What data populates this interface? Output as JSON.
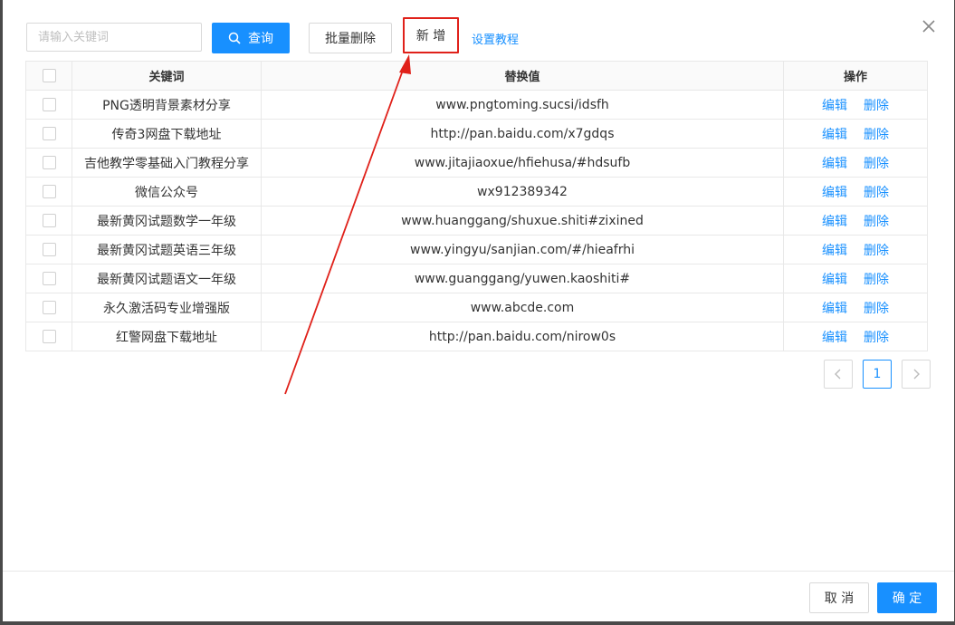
{
  "toolbar": {
    "search_placeholder": "请输入关键词",
    "search_label": "查询",
    "batch_delete_label": "批量删除",
    "add_label": "新 增",
    "tutorial_label": "设置教程"
  },
  "table": {
    "headers": {
      "keyword": "关键词",
      "value": "替换值",
      "actions": "操作"
    },
    "rows": [
      {
        "keyword": "PNG透明背景素材分享",
        "value": "www.pngtoming.sucsi/idsfh",
        "edit": "编辑",
        "delete": "删除"
      },
      {
        "keyword": "传奇3网盘下载地址",
        "value": "http://pan.baidu.com/x7gdqs",
        "edit": "编辑",
        "delete": "删除"
      },
      {
        "keyword": "吉他教学零基础入门教程分享",
        "value": "www.jitajiaoxue/hfiehusa/#hdsufb",
        "edit": "编辑",
        "delete": "删除"
      },
      {
        "keyword": "微信公众号",
        "value": "wx912389342",
        "edit": "编辑",
        "delete": "删除"
      },
      {
        "keyword": "最新黄冈试题数学一年级",
        "value": "www.huanggang/shuxue.shiti#zixined",
        "edit": "编辑",
        "delete": "删除"
      },
      {
        "keyword": "最新黄冈试题英语三年级",
        "value": "www.yingyu/sanjian.com/#/hieafrhi",
        "edit": "编辑",
        "delete": "删除"
      },
      {
        "keyword": "最新黄冈试题语文一年级",
        "value": "www.guanggang/yuwen.kaoshiti#",
        "edit": "编辑",
        "delete": "删除"
      },
      {
        "keyword": "永久激活码专业增强版",
        "value": "www.abcde.com",
        "edit": "编辑",
        "delete": "删除"
      },
      {
        "keyword": "红警网盘下载地址",
        "value": "http://pan.baidu.com/nirow0s",
        "edit": "编辑",
        "delete": "删除"
      }
    ]
  },
  "pagination": {
    "current_page": "1"
  },
  "footer": {
    "cancel_label": "取 消",
    "ok_label": "确 定"
  },
  "icons": {
    "close": "close-icon",
    "search": "search-icon",
    "prev": "chevron-left-icon",
    "next": "chevron-right-icon"
  },
  "colors": {
    "primary": "#1890ff",
    "highlight": "#e0211a"
  }
}
